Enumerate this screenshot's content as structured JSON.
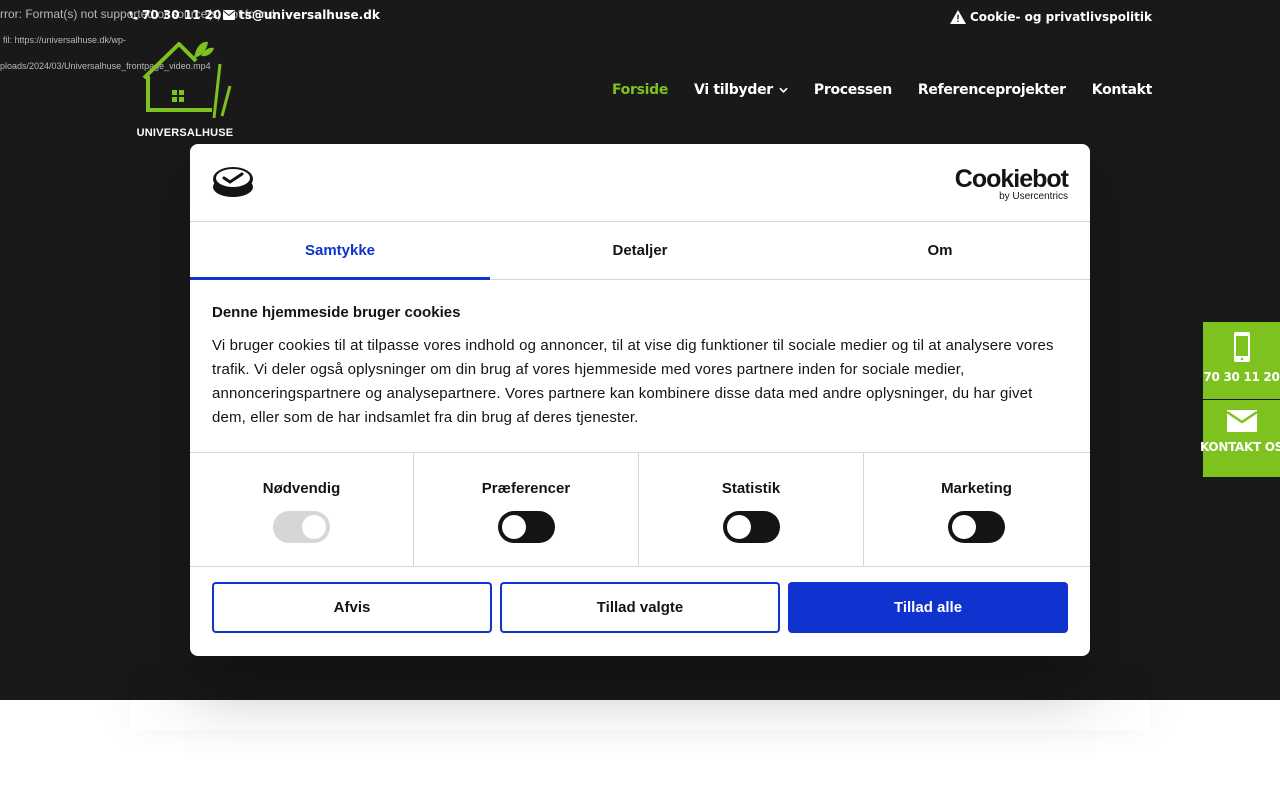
{
  "error": {
    "line1": "rror: Format(s) not supported or source(s) not found",
    "line2": "fil: https://universalhuse.dk/wp-",
    "line3": "ploads/2024/03/Universalhuse_frontpage_video.mp4"
  },
  "topbar": {
    "phone": "70 30 11 20",
    "email": "ts@universalhuse.dk",
    "policy": "Cookie- og privatlivspolitik"
  },
  "logo": {
    "text": "UNIVERSALHUSE"
  },
  "nav": {
    "items": [
      {
        "label": "Forside"
      },
      {
        "label": "Vi tilbyder"
      },
      {
        "label": "Processen"
      },
      {
        "label": "Referenceprojekter"
      },
      {
        "label": "Kontakt"
      }
    ]
  },
  "side_widget": {
    "phone_label": "70 30 11 20",
    "contact_label": "KONTAKT OS"
  },
  "cookie_dialog": {
    "brand_main": "Cookiebot",
    "brand_sub": "by Usercentrics",
    "tabs": [
      {
        "label": "Samtykke"
      },
      {
        "label": "Detaljer"
      },
      {
        "label": "Om"
      }
    ],
    "title": "Denne hjemmeside bruger cookies",
    "body": "Vi bruger cookies til at tilpasse vores indhold og annoncer, til at vise dig funktioner til sociale medier og til at analysere vores trafik. Vi deler også oplysninger om din brug af vores hjemmeside med vores partnere inden for sociale medier, annonceringspartnere og analysepartnere. Vores partnere kan kombinere disse data med andre oplysninger, du har givet dem, eller som de har indsamlet fra din brug af deres tjenester.",
    "consents": [
      {
        "label": "Nødvendig",
        "state": "on-disabled"
      },
      {
        "label": "Præferencer",
        "state": "off"
      },
      {
        "label": "Statistik",
        "state": "off"
      },
      {
        "label": "Marketing",
        "state": "off"
      }
    ],
    "buttons": {
      "decline": "Afvis",
      "allow_selected": "Tillad valgte",
      "allow_all": "Tillad alle"
    }
  },
  "colors": {
    "accent_green": "#7dc21e",
    "cookiebot_blue": "#1032cf",
    "hero_bg": "#191919"
  }
}
